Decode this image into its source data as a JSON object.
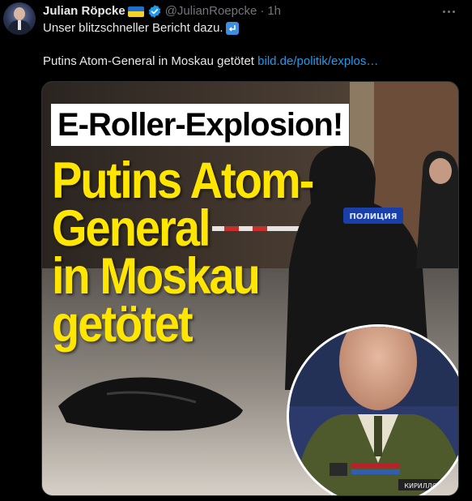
{
  "author": {
    "name": "Julian Röpcke",
    "handle": "@JulianRoepcke",
    "separator": "·",
    "time": "1h"
  },
  "tweet": {
    "text_line": "Unser blitzschneller Bericht dazu.",
    "headline_text": "Putins Atom-General in Moskau getötet",
    "link_text": "bild.de/politik/explos…"
  },
  "media": {
    "headline_box": "E-Roller-Explosion!",
    "title_lines": [
      "Putins Atom-",
      "General",
      "in Moskau",
      "getötet"
    ],
    "police_patch": "ПОЛИЦИЯ",
    "name_tag_left": "КИРИЛЛОВ И.А."
  },
  "icons": {
    "verified": "verified-badge-icon",
    "more": "more-icon",
    "return": "return-arrow-icon",
    "flag": "ukraine-flag-icon"
  },
  "colors": {
    "background": "#000000",
    "text": "#e7e9ea",
    "muted": "#71767b",
    "link": "#1d9bf0",
    "title_yellow": "#ffe600"
  }
}
